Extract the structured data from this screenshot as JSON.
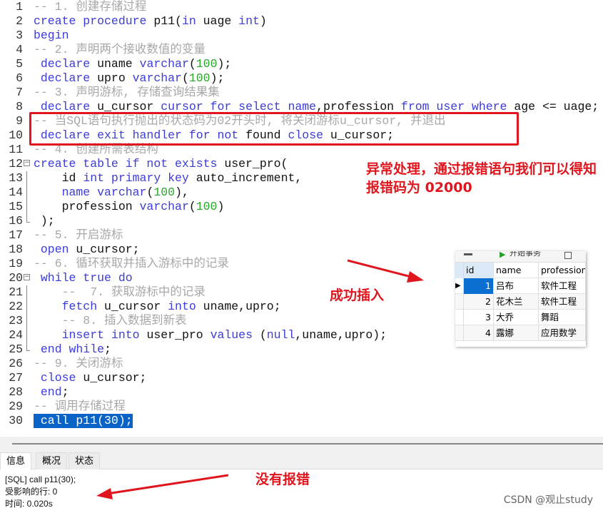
{
  "editor": {
    "selected_line": 30,
    "lines": [
      [
        [
          "c",
          "-- 1. 创建存储过程"
        ]
      ],
      [
        [
          "k",
          "create procedure "
        ],
        [
          "i",
          "p11("
        ],
        [
          "k",
          "in "
        ],
        [
          "i",
          "uage "
        ],
        [
          "k",
          "int"
        ],
        [
          "i",
          ")"
        ]
      ],
      [
        [
          "k",
          "begin"
        ]
      ],
      [
        [
          "c",
          "-- 2. 声明两个接收数值的变量"
        ]
      ],
      [
        [
          "k",
          " declare "
        ],
        [
          "i",
          "uname "
        ],
        [
          "k",
          "varchar"
        ],
        [
          "i",
          "("
        ],
        [
          "n",
          "100"
        ],
        [
          "i",
          ");"
        ]
      ],
      [
        [
          "k",
          " declare "
        ],
        [
          "i",
          "upro "
        ],
        [
          "k",
          "varchar"
        ],
        [
          "i",
          "("
        ],
        [
          "n",
          "100"
        ],
        [
          "i",
          ");"
        ]
      ],
      [
        [
          "c",
          "-- 3. 声明游标, 存储查询结果集"
        ]
      ],
      [
        [
          "k",
          " declare "
        ],
        [
          "i",
          "u_cursor "
        ],
        [
          "k",
          "cursor for select name"
        ],
        [
          "i",
          ",profession "
        ],
        [
          "k",
          "from user where "
        ],
        [
          "i",
          "age <= uage;"
        ]
      ],
      [
        [
          "c",
          "-- 当SQL语句执行抛出的状态码为02开头时, 将关闭游标u_cursor, 并退出"
        ]
      ],
      [
        [
          "k",
          " declare exit handler for not "
        ],
        [
          "i",
          "found "
        ],
        [
          "k",
          "close "
        ],
        [
          "i",
          "u_cursor;"
        ]
      ],
      [
        [
          "c",
          "-- 4. 创建所需表结构"
        ]
      ],
      [
        [
          "k",
          "create table if not exists "
        ],
        [
          "i",
          "user_pro("
        ]
      ],
      [
        [
          "i",
          "    id "
        ],
        [
          "k",
          "int primary key "
        ],
        [
          "i",
          "auto_increment,"
        ]
      ],
      [
        [
          "k",
          "    name varchar"
        ],
        [
          "i",
          "("
        ],
        [
          "n",
          "100"
        ],
        [
          "i",
          "),"
        ]
      ],
      [
        [
          "i",
          "    profession "
        ],
        [
          "k",
          "varchar"
        ],
        [
          "i",
          "("
        ],
        [
          "n",
          "100"
        ],
        [
          "i",
          ")"
        ]
      ],
      [
        [
          "i",
          " );"
        ]
      ],
      [
        [
          "c",
          "-- 5. 开启游标"
        ]
      ],
      [
        [
          "k",
          " open "
        ],
        [
          "i",
          "u_cursor;"
        ]
      ],
      [
        [
          "c",
          "-- 6. 循环获取并插入游标中的记录"
        ]
      ],
      [
        [
          "k",
          " while true do"
        ]
      ],
      [
        [
          "c",
          "    --  7. 获取游标中的记录"
        ]
      ],
      [
        [
          "k",
          "    fetch "
        ],
        [
          "i",
          "u_cursor "
        ],
        [
          "k",
          "into "
        ],
        [
          "i",
          "uname,upro;"
        ]
      ],
      [
        [
          "c",
          "    -- 8. 插入数据到新表"
        ]
      ],
      [
        [
          "k",
          "    insert into "
        ],
        [
          "i",
          "user_pro "
        ],
        [
          "k",
          "values "
        ],
        [
          "i",
          "("
        ],
        [
          "k",
          "null"
        ],
        [
          "i",
          ",uname,upro);"
        ]
      ],
      [
        [
          "k",
          " end while"
        ],
        [
          "i",
          ";"
        ]
      ],
      [
        [
          "c",
          "-- 9. 关闭游标"
        ]
      ],
      [
        [
          "k",
          " close "
        ],
        [
          "i",
          "u_cursor;"
        ]
      ],
      [
        [
          "k",
          " end"
        ],
        [
          "i",
          ";"
        ]
      ],
      [
        [
          "c",
          "-- 调用存储过程"
        ]
      ],
      [
        [
          "i",
          " call p11(30);"
        ]
      ]
    ],
    "fold_start": [
      12,
      20
    ],
    "fold_end": [
      16,
      25
    ]
  },
  "annotations": {
    "error_handling": "异常处理，通过报错语句我们可以得知报错码为  02000",
    "insert_success": "成功插入",
    "no_error": "没有报错",
    "color": "#e0161f"
  },
  "result_grid": {
    "toolbar": "开始事务",
    "columns": [
      "id",
      "name",
      "profession"
    ],
    "rows": [
      [
        "1",
        "吕布",
        "软件工程"
      ],
      [
        "2",
        "花木兰",
        "软件工程"
      ],
      [
        "3",
        "大乔",
        "舞蹈"
      ],
      [
        "4",
        "露娜",
        "应用数学"
      ]
    ]
  },
  "tabs": [
    "信息",
    "概况",
    "状态"
  ],
  "messages": [
    "[SQL] call p11(30);",
    "受影响的行: 0",
    "时间: 0.020s"
  ],
  "watermark": "CSDN @观止study"
}
